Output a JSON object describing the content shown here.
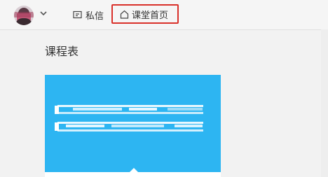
{
  "header": {
    "messages_label": "私信",
    "home_label": "课堂首页"
  },
  "main": {
    "title": "课程表"
  },
  "colors": {
    "highlight_border": "#d9302a",
    "card_blue": "#2db5f2"
  }
}
